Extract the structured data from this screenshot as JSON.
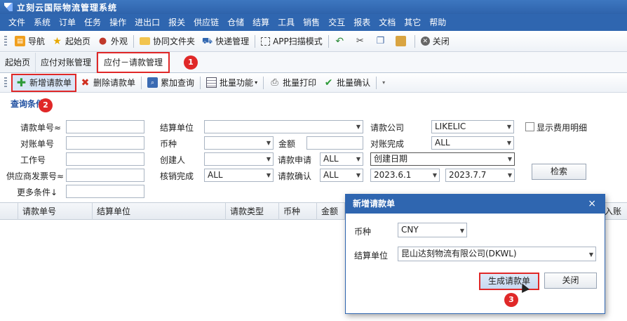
{
  "window": {
    "title": "立刻云国际物流管理系统"
  },
  "menu": [
    "文件",
    "系统",
    "订单",
    "任务",
    "操作",
    "进出口",
    "报关",
    "供应链",
    "仓储",
    "结算",
    "工具",
    "销售",
    "交互",
    "报表",
    "文档",
    "其它",
    "帮助"
  ],
  "toolbar": {
    "nav": "导航",
    "home": "起始页",
    "appearance": "外观",
    "shared_folder": "协同文件夹",
    "express": "快递管理",
    "app_scan": "APP扫描模式",
    "close": "关闭"
  },
  "tabs": [
    "起始页",
    "应付对账管理",
    "应付－请款管理"
  ],
  "badges": [
    "1",
    "2",
    "3"
  ],
  "actions": {
    "new": "新增请款单",
    "delete": "删除请款单",
    "accumulate": "累加查询",
    "batch": "批量功能",
    "batch_print": "批量打印",
    "batch_confirm": "批量确认"
  },
  "query": {
    "title": "查询条件",
    "request_no": "请款单号≈",
    "recon_no": "对账单号",
    "job_no": "工作号",
    "supplier_invoice": "供应商发票号≈",
    "more": "更多条件↓",
    "settle_unit": "结算单位",
    "currency": "币种",
    "creator": "创建人",
    "writeoff": "核销完成",
    "writeoff_value": "ALL",
    "amount": "金额",
    "request_apply": "请款申请",
    "request_apply_value": "ALL",
    "request_confirm": "请款确认",
    "request_confirm_value": "ALL",
    "company": "请款公司",
    "company_value": "LIKELIC",
    "recon_done": "对账完成",
    "recon_done_value": "ALL",
    "date_type": "创建日期",
    "date_from": "2023.6.1",
    "date_to": "2023.7.7",
    "show_detail": "显示费用明细",
    "search": "检索"
  },
  "grid": {
    "columns": [
      "请款单号",
      "结算单位",
      "请款类型",
      "币种",
      "金额"
    ],
    "right_cut": "入账"
  },
  "dialog": {
    "title": "新增请款单",
    "close_x": "×",
    "currency_label": "币种",
    "currency_value": "CNY",
    "unit_label": "结算单位",
    "unit_value": "昆山达刻物流有限公司(DKWL)",
    "generate": "生成请款单",
    "close": "关闭"
  },
  "colors": {
    "accent": "#2f66b0",
    "highlight": "#e02828"
  }
}
